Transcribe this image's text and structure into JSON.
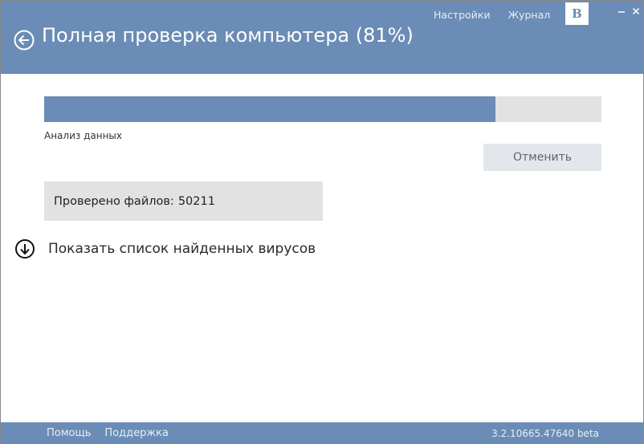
{
  "header": {
    "title": "Полная проверка компьютера (81%)",
    "links": [
      "Настройки",
      "Журнал"
    ],
    "vk_label": "B",
    "accent_color": "#6a8cb6"
  },
  "progress": {
    "percent": 81,
    "status": "Анализ данных"
  },
  "cancel_label": "Отменить",
  "files": {
    "label": "Проверено файлов:",
    "count": "50211"
  },
  "show_list_label": "Показать список найденных вирусов",
  "footer": {
    "links": [
      "Помощь",
      "Поддержка"
    ],
    "version": "3.2.10665.47640 beta"
  },
  "icons": {
    "back": "back-arrow-circle-icon",
    "show_list": "arrow-down-circle-icon",
    "minimize": "minimize-icon",
    "close": "close-icon"
  }
}
